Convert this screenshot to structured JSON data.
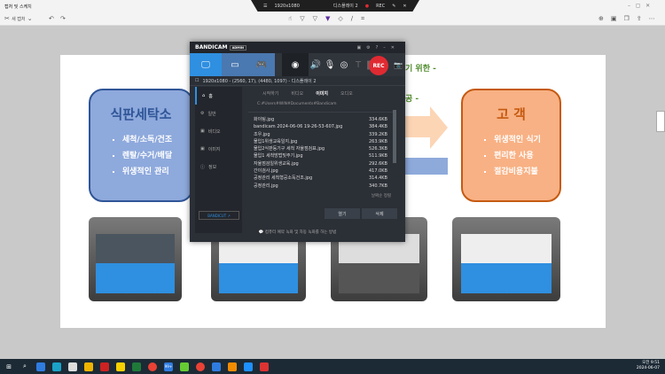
{
  "window": {
    "title": "캡처 및 스케치",
    "new_capture": "새 캡처"
  },
  "recbar": {
    "resolution": "1920x1080",
    "display": "디스플레이 2",
    "rec": "REC"
  },
  "slide": {
    "left_box": {
      "title": "식판세탁소",
      "items": [
        "세척/소독/건조",
        "렌탈/수거/배달",
        "위생적인 관리"
      ]
    },
    "right_box": {
      "title": "고 객",
      "items": [
        "위생적인 식기",
        "편리한 사용",
        "절감비용지불"
      ]
    },
    "line1": "기 위한 -",
    "line2": "공 -"
  },
  "bandicam": {
    "logo": "BANDICAM",
    "badge": "ADMIN",
    "rec": "REC",
    "target": "1920x1080 - (2560, 17), (4480, 1097) - 디스플레이 2",
    "sidebar": [
      "홈",
      "일반",
      "비디오",
      "이미지",
      "정보"
    ],
    "bandicut": "BANDICUT ↗",
    "tabs": [
      "시작하기",
      "비디오",
      "이미지",
      "오디오"
    ],
    "path": "C:#Users#WIN#Documents#Bandicam",
    "files": [
      {
        "name": "화이팅.jpg",
        "size": "334.6KB"
      },
      {
        "name": "bandicam 2024-06-06 19-26-53-607.jpg",
        "size": "384.4KB"
      },
      {
        "name": "조우.jpg",
        "size": "339.2KB"
      },
      {
        "name": "물입1위생교육일지.jpg",
        "size": "263.9KB"
      },
      {
        "name": "물입2식판등기구 세척 자율점검표.jpg",
        "size": "526.3KB"
      },
      {
        "name": "물입1 세척방법및주기.jpg",
        "size": "511.9KB"
      },
      {
        "name": "자율점검일위생교육.jpg",
        "size": "292.6KB"
      },
      {
        "name": "간이검사.jpg",
        "size": "417.0KB"
      },
      {
        "name": "공정관리 세척형공소독건조.jpg",
        "size": "314.4KB"
      },
      {
        "name": "공정관리.jpg",
        "size": "340.7KB"
      }
    ],
    "sort": "날짜순 정렬",
    "open": "열기",
    "delete": "삭제",
    "footer": "컴퓨터 예약 녹화 및 자동 녹화를 하는 방법"
  },
  "taskbar": {
    "time": "오전 9:51",
    "date": "2024-06-07",
    "badge": "99+"
  }
}
